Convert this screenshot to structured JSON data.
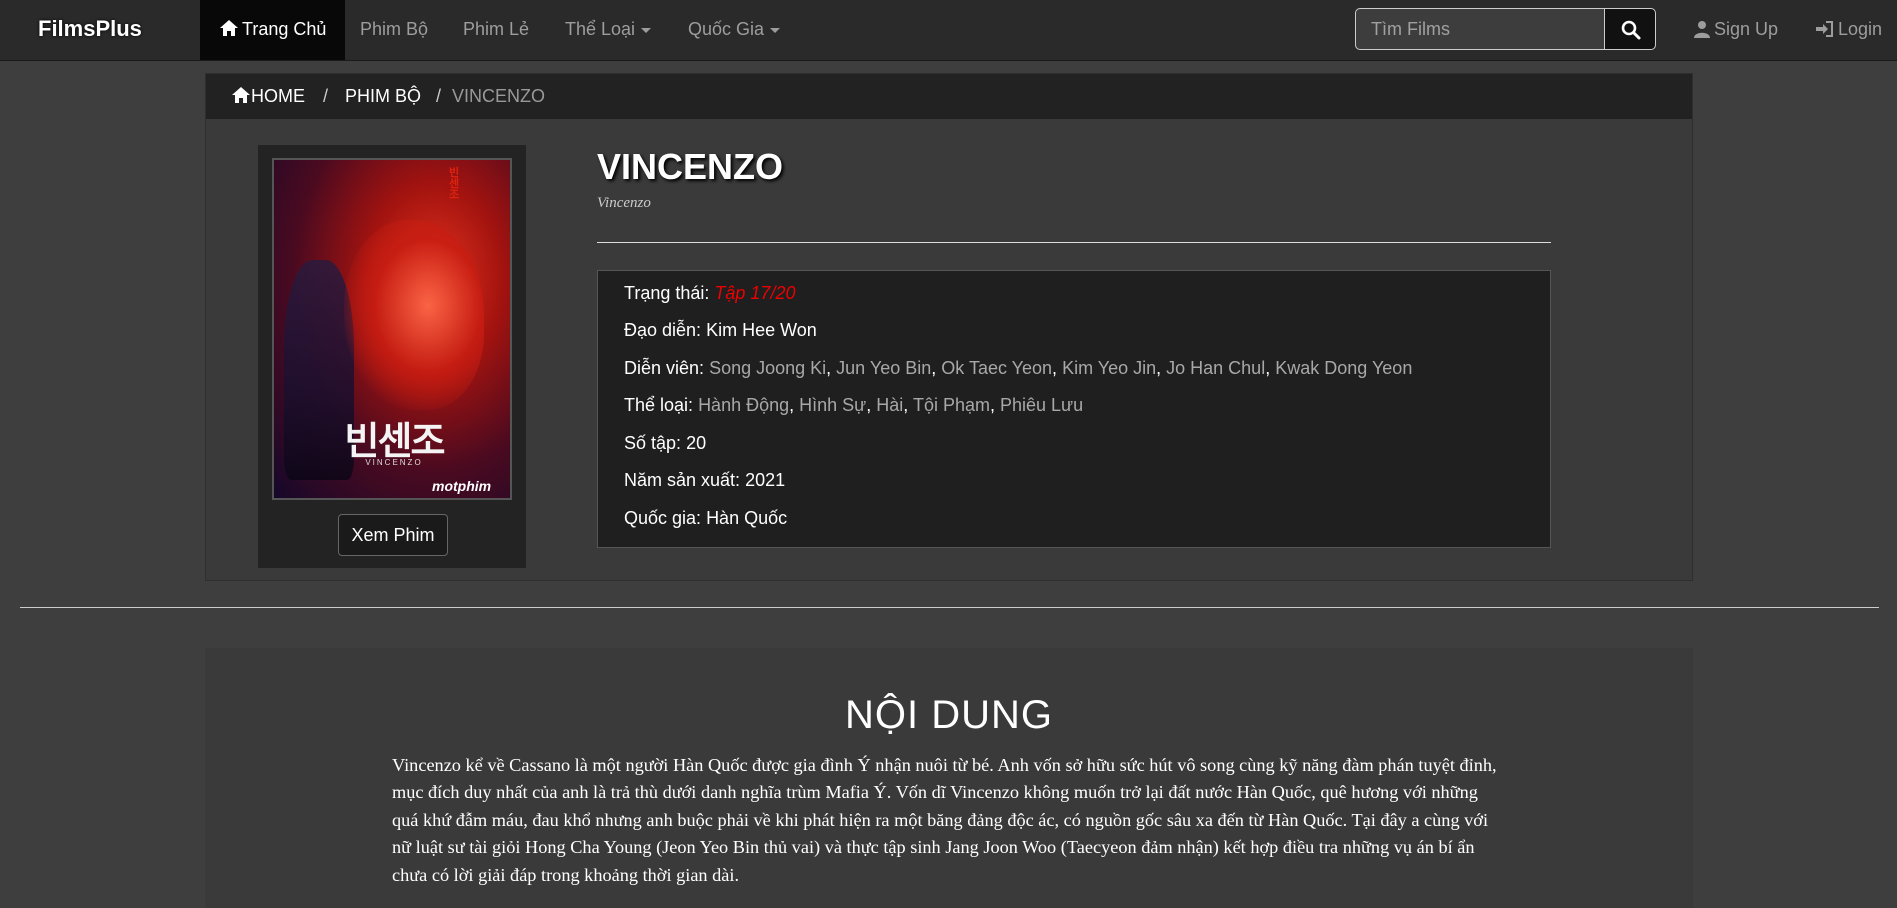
{
  "navbar": {
    "brand": "FilmsPlus",
    "items": [
      {
        "label": "Trang Chủ",
        "active": true
      },
      {
        "label": "Phim Bộ"
      },
      {
        "label": "Phim Lẻ"
      },
      {
        "label": "Thể Loại",
        "dropdown": true
      },
      {
        "label": "Quốc Gia",
        "dropdown": true
      }
    ],
    "search_placeholder": "Tìm Films",
    "signup": "Sign Up",
    "login": "Login"
  },
  "breadcrumb": {
    "home": "HOME",
    "section": "PHIM BỘ",
    "current": "VINCENZO",
    "separator": "/"
  },
  "poster": {
    "korean_title": "빈센조",
    "english_title": "VINCENZO",
    "watermark": "motphim"
  },
  "movie": {
    "title": "VINCENZO",
    "original_title": "Vincenzo",
    "watch_button": "Xem Phim",
    "status_label": "Trạng thái:",
    "status_value": "Tập 17/20",
    "director_label": "Đạo diễn:",
    "director_value": "Kim Hee Won",
    "cast_label": "Diễn viên:",
    "cast": [
      "Song Joong Ki",
      "Jun Yeo Bin",
      "Ok Taec Yeon",
      "Kim Yeo Jin",
      "Jo Han Chul",
      "Kwak Dong Yeon"
    ],
    "genre_label": "Thể loại:",
    "genres": [
      "Hành Động",
      "Hình Sự",
      "Hài",
      "Tội Phạm",
      "Phiêu Lưu"
    ],
    "episodes_label": "Số tập:",
    "episodes_value": "20",
    "year_label": "Năm sản xuất:",
    "year_value": "2021",
    "country_label": "Quốc gia:",
    "country_value": "Hàn Quốc"
  },
  "content": {
    "heading": "NỘI DUNG",
    "body": "Vincenzo kể về Cassano là một người Hàn Quốc được gia đình Ý nhận nuôi từ bé. Anh vốn sở hữu sức hút vô song cùng kỹ năng đàm phán tuyệt đỉnh, mục đích duy nhất của anh là trả thù dưới danh nghĩa trùm Mafia Ý. Vốn dĩ Vincenzo không muốn trở lại đất nước Hàn Quốc, quê hương với những quá khứ đẫm máu, đau khổ nhưng anh buộc phải về khi phát hiện ra một băng đảng độc ác, có nguồn gốc sâu xa đến từ Hàn Quốc. Tại đây a cùng với nữ luật sư tài giỏi Hong Cha Young (Jeon Yeo Bin thủ vai) và thực tập sinh Jang Joon Woo (Taecyeon đảm nhận) kết hợp điều tra những vụ án bí ẩn chưa có lời giải đáp trong khoảng thời gian dài."
  },
  "colors": {
    "status": "#ee0000",
    "navbar_bg": "#2a2a2a",
    "page_bg": "#3e3e3e"
  }
}
